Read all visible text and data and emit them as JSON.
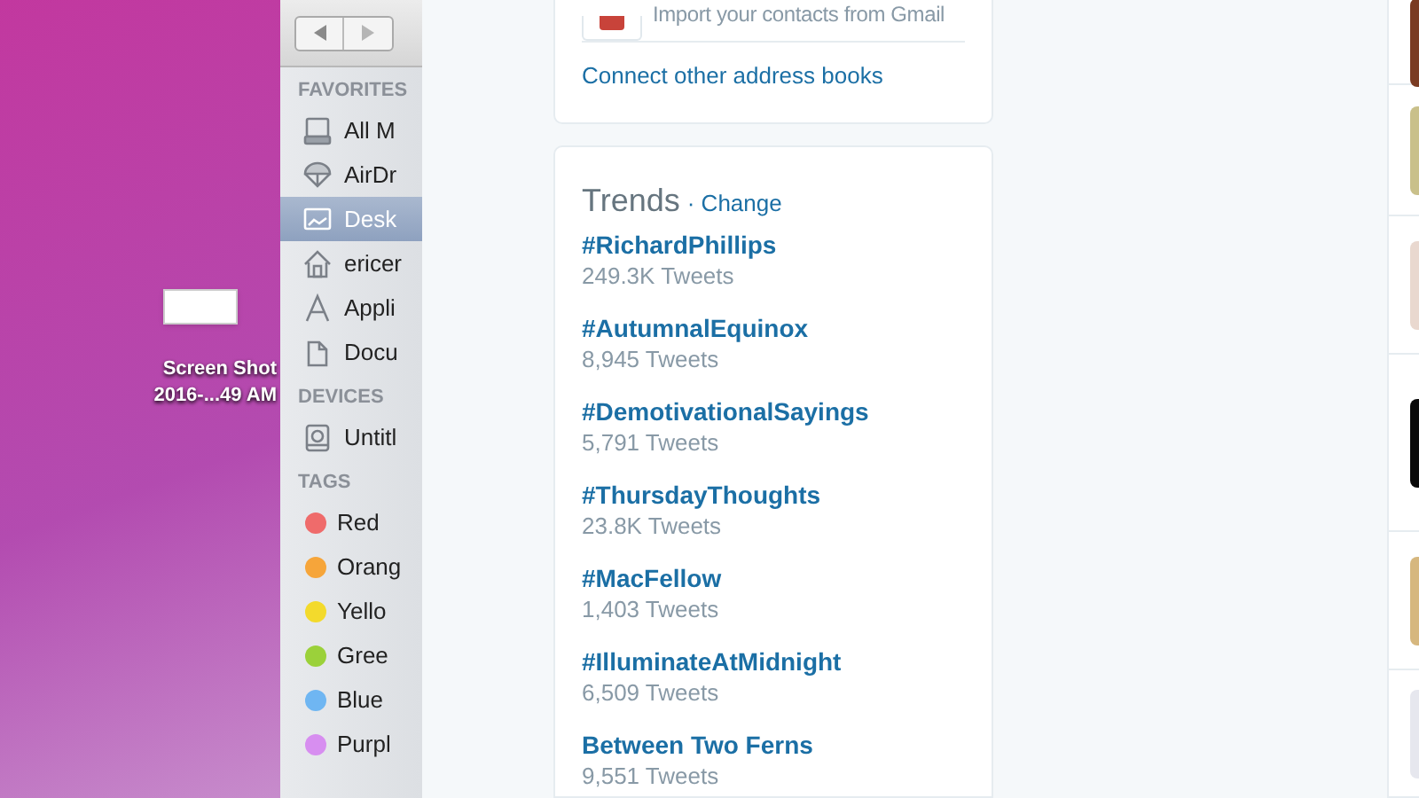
{
  "desktop": {
    "file_icon": {
      "label_lines": [
        "Screen Shot",
        "2016-...49 AM"
      ]
    }
  },
  "finder_sidebar": {
    "sections": [
      {
        "title": "FAVORITES",
        "items": [
          {
            "label": "All M",
            "selected": false
          },
          {
            "label": "AirDr",
            "selected": false
          },
          {
            "label": "Desk",
            "selected": true
          },
          {
            "label": "ericer",
            "selected": false
          },
          {
            "label": "Appli",
            "selected": false
          },
          {
            "label": "Docu",
            "selected": false
          }
        ]
      },
      {
        "title": "DEVICES",
        "items": [
          {
            "label": "Untitl",
            "selected": false
          }
        ]
      },
      {
        "title": "TAGS",
        "items": [
          {
            "label": "Red",
            "color": "#ef6b6b"
          },
          {
            "label": "Orang",
            "color": "#f6a53a"
          },
          {
            "label": "Yello",
            "color": "#f3da2c"
          },
          {
            "label": "Gree",
            "color": "#9bd13a"
          },
          {
            "label": "Blue",
            "color": "#6fb6f2"
          },
          {
            "label": "Purpl",
            "color": "#d78ef0"
          }
        ]
      }
    ]
  },
  "contacts_card": {
    "import_text": "Import your contacts from Gmail",
    "link": "Connect other address books"
  },
  "trends": {
    "title": "Trends",
    "change_link": "· Change",
    "items": [
      {
        "name": "#RichardPhillips",
        "count": "249.3K Tweets"
      },
      {
        "name": "#AutumnalEquinox",
        "count": "8,945 Tweets"
      },
      {
        "name": "#DemotivationalSayings",
        "count": "5,791 Tweets"
      },
      {
        "name": "#ThursdayThoughts",
        "count": "23.8K Tweets"
      },
      {
        "name": "#MacFellow",
        "count": "1,403 Tweets"
      },
      {
        "name": "#IlluminateAtMidnight",
        "count": "6,509 Tweets"
      },
      {
        "name": "Between Two Ferns",
        "count": "9,551 Tweets"
      }
    ]
  }
}
